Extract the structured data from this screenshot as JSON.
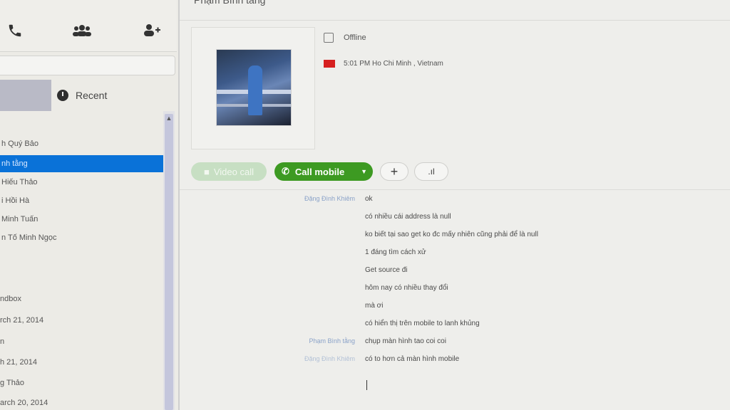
{
  "sidebar": {
    "toolbar_icons": [
      "phone-icon",
      "group-icon",
      "add-contact-icon"
    ],
    "tabs": {
      "recent_label": "Recent"
    },
    "contacts": [
      {
        "name": "h Quý Bảo",
        "selected": false
      },
      {
        "name": "nh tằng",
        "selected": true
      },
      {
        "name": "Hiếu Thảo",
        "selected": false
      },
      {
        "name": "i Hồi Hà",
        "selected": false
      },
      {
        "name": "Minh Tuấn",
        "selected": false
      },
      {
        "name": "n Tố Minh Ngọc",
        "selected": false
      }
    ],
    "recent": [
      {
        "text": "ndbox"
      },
      {
        "text": "rch 21, 2014"
      },
      {
        "text": "n"
      },
      {
        "text": "h 21, 2014"
      },
      {
        "text": "g Thảo"
      },
      {
        "text": "arch 20, 2014"
      }
    ]
  },
  "main": {
    "title": "Phạm Bình tằng",
    "status": "Offline",
    "location": "5:01 PM Ho Chi Minh , Vietnam",
    "buttons": {
      "video_call": "Video call",
      "call_mobile": "Call mobile",
      "add": "+",
      "signal": ".ıl"
    },
    "chat": [
      {
        "sender": "Đặng Đình Khiêm",
        "text": "ok"
      },
      {
        "sender": "",
        "text": "có nhiều cái address là null"
      },
      {
        "sender": "",
        "text": "ko biết tại sao get ko đc mấy nhiên cũng phải để là null"
      },
      {
        "sender": "",
        "text": "1 đáng tìm cách xử"
      },
      {
        "sender": "",
        "text": "Get source đi"
      },
      {
        "sender": "",
        "text": "hôm nay có nhiều thay đổi"
      },
      {
        "sender": "",
        "text": "mà ơi"
      },
      {
        "sender": "",
        "text": "có hiển thị trên mobile to lanh khủng"
      },
      {
        "sender": "Phạm Bình tằng",
        "text": "chụp màn hình tao coi coi"
      },
      {
        "sender": "Đặng Đình Khiêm",
        "text": "có to hơn cả màn hình mobile"
      }
    ]
  },
  "colors": {
    "selected": "#0a72d8",
    "call_green": "#3d9a22",
    "video_disabled": "#c7dfc3",
    "flag_red": "#d61f1f"
  }
}
